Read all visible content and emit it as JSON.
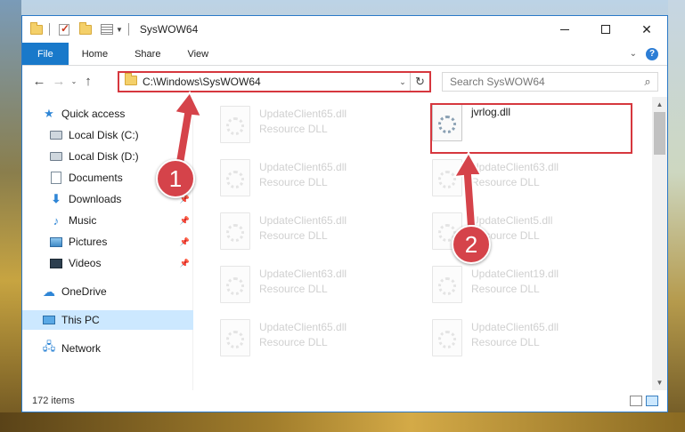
{
  "window": {
    "title": "SysWOW64"
  },
  "ribbon": {
    "tabs": [
      {
        "label": "File"
      },
      {
        "label": "Home"
      },
      {
        "label": "Share"
      },
      {
        "label": "View"
      }
    ]
  },
  "address": {
    "path": "C:\\Windows\\SysWOW64"
  },
  "search": {
    "placeholder": "Search SysWOW64"
  },
  "nav": {
    "items": [
      {
        "label": "Quick access",
        "icon": "star-icon"
      },
      {
        "label": "Local Disk (C:)",
        "icon": "drive-icon"
      },
      {
        "label": "Local Disk (D:)",
        "icon": "drive-icon"
      },
      {
        "label": "Documents",
        "icon": "documents-icon"
      },
      {
        "label": "Downloads",
        "icon": "download-icon"
      },
      {
        "label": "Music",
        "icon": "music-icon"
      },
      {
        "label": "Pictures",
        "icon": "pictures-icon"
      },
      {
        "label": "Videos",
        "icon": "videos-icon"
      },
      {
        "label": "OneDrive",
        "icon": "cloud-icon"
      },
      {
        "label": "This PC",
        "icon": "computer-icon"
      },
      {
        "label": "Network",
        "icon": "network-icon"
      }
    ]
  },
  "files": [
    {
      "name": "UpdateClient65.dll",
      "type": "Resource DLL"
    },
    {
      "name": "jvrlog.dll",
      "type": ""
    },
    {
      "name": "UpdateClient65.dll",
      "type": "Resource DLL"
    },
    {
      "name": "UpdateClient63.dll",
      "type": "Resource DLL"
    },
    {
      "name": "UpdateClient65.dll",
      "type": "Resource DLL"
    },
    {
      "name": "UpdateClient5.dll",
      "type": "Resource DLL"
    },
    {
      "name": "UpdateClient63.dll",
      "type": "Resource DLL"
    },
    {
      "name": "UpdateClient19.dll",
      "type": "Resource DLL"
    },
    {
      "name": "UpdateClient65.dll",
      "type": "Resource DLL"
    },
    {
      "name": "UpdateClient65.dll",
      "type": "Resource DLL"
    }
  ],
  "status": {
    "item_count": "172 items"
  },
  "annotations": {
    "badge1": "1",
    "badge2": "2"
  },
  "colors": {
    "accent": "#1979ca",
    "highlight": "#d6373e"
  }
}
